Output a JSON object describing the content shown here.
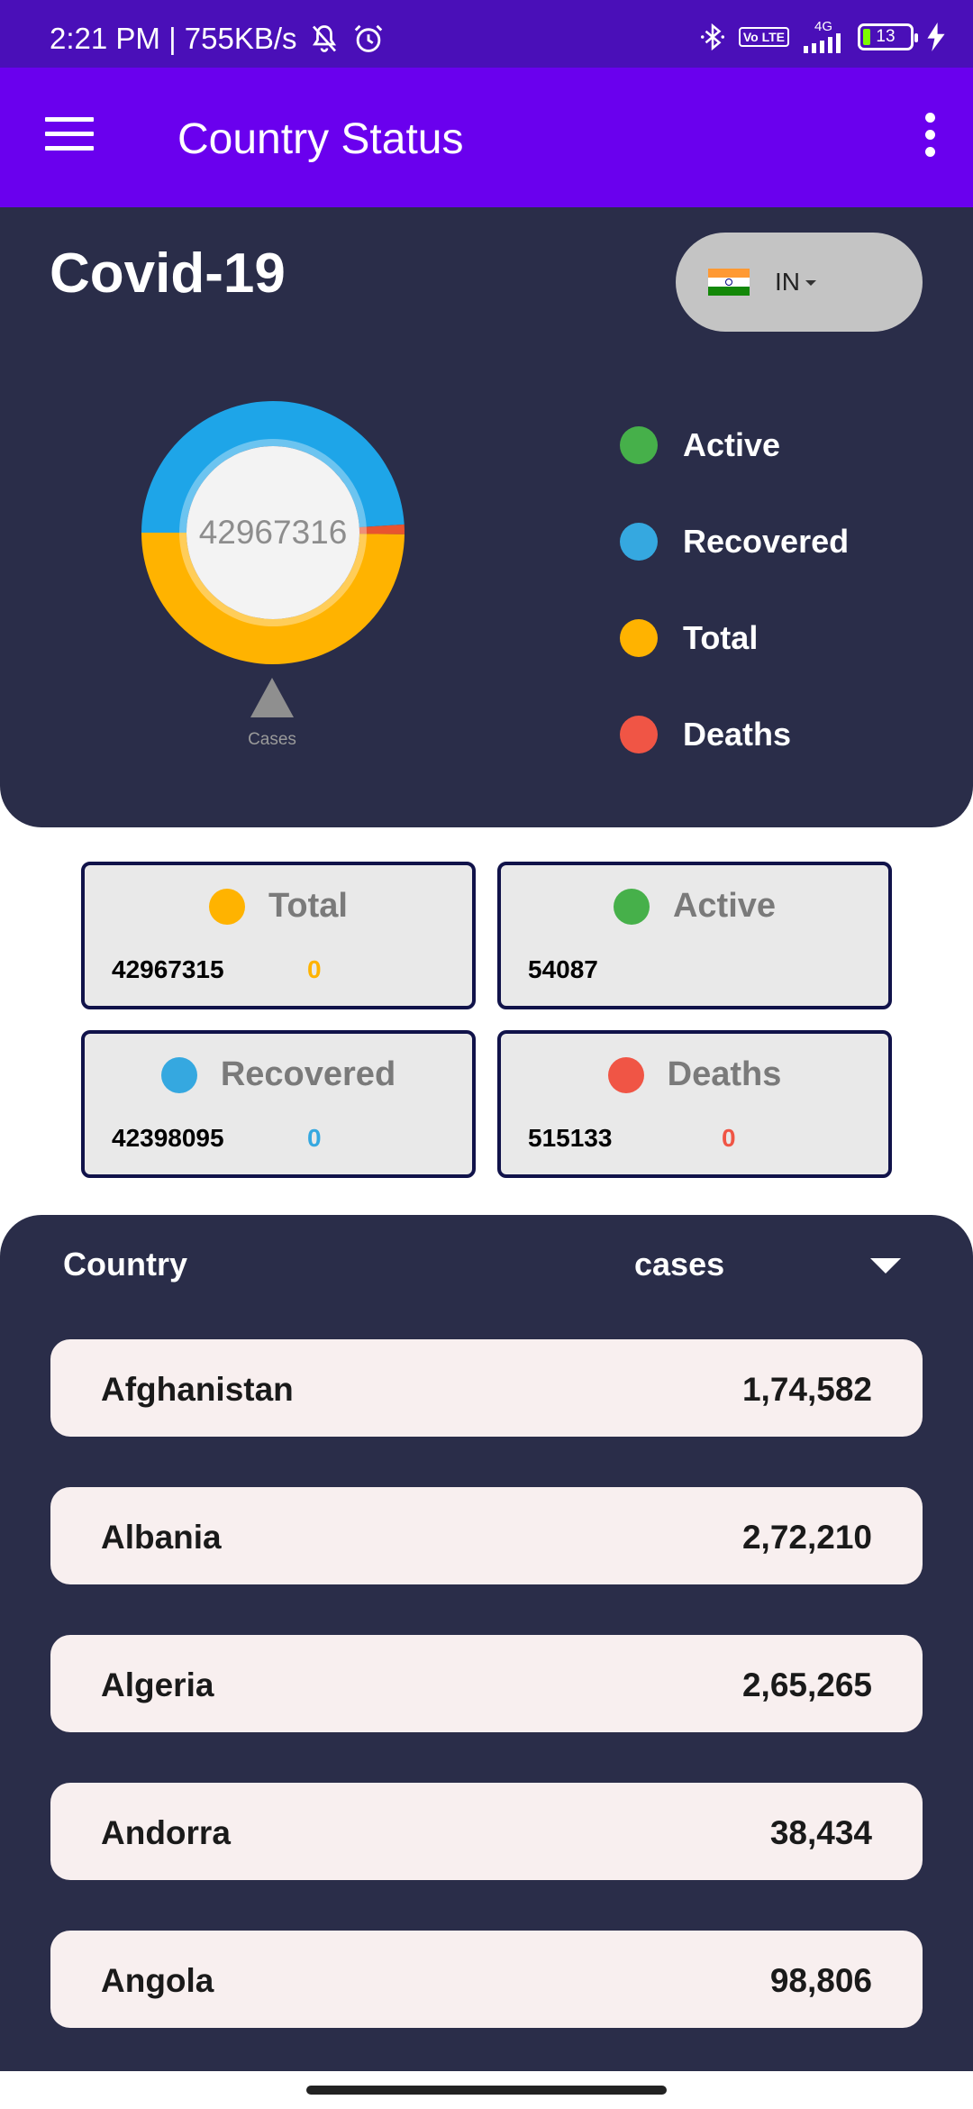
{
  "status_bar": {
    "time_speed": "2:21 PM | 755KB/s",
    "network": "4G",
    "volte": "Vo LTE",
    "battery": "13",
    "icons": [
      "mute-bell-icon",
      "alarm-icon",
      "bluetooth-icon",
      "signal-icon",
      "battery-icon",
      "charging-icon"
    ]
  },
  "appbar": {
    "title": "Country Status",
    "icons": [
      "hamburger-menu-icon",
      "more-vert-icon"
    ]
  },
  "header": {
    "title": "Covid-19",
    "country_code": "IN",
    "flag": "india-flag-icon"
  },
  "donut": {
    "center_value": "42967316",
    "caption": "Cases",
    "segments": [
      {
        "name": "Recovered",
        "color": "#1ea5e8",
        "fraction": 0.49
      },
      {
        "name": "Deaths",
        "color": "#e8542f",
        "fraction": 0.012
      },
      {
        "name": "Total",
        "color": "#ffb300",
        "fraction": 0.498
      }
    ]
  },
  "legend": [
    {
      "label": "Active",
      "color": "#46b04a"
    },
    {
      "label": "Recovered",
      "color": "#35a8e0"
    },
    {
      "label": "Total",
      "color": "#ffb300"
    },
    {
      "label": "Deaths",
      "color": "#f05545"
    }
  ],
  "cards": {
    "total": {
      "label": "Total",
      "value": "42967315",
      "delta": "0",
      "color": "#ffb300"
    },
    "active": {
      "label": "Active",
      "value": "54087",
      "color": "#46b04a"
    },
    "recovered": {
      "label": "Recovered",
      "value": "42398095",
      "delta": "0",
      "color": "#35a8e0"
    },
    "deaths": {
      "label": "Deaths",
      "value": "515133",
      "delta": "0",
      "color": "#f05545"
    }
  },
  "list": {
    "header_country": "Country",
    "header_cases": "cases",
    "rows": [
      {
        "country": "Afghanistan",
        "cases": "1,74,582"
      },
      {
        "country": "Albania",
        "cases": "2,72,210"
      },
      {
        "country": "Algeria",
        "cases": "2,65,265"
      },
      {
        "country": "Andorra",
        "cases": "38,434"
      },
      {
        "country": "Angola",
        "cases": "98,806"
      }
    ]
  }
}
